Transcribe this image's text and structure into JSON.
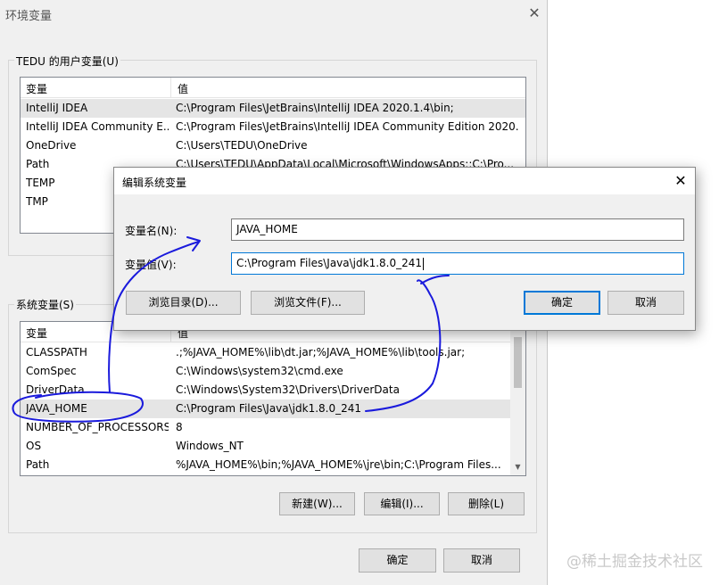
{
  "main": {
    "title": "环境变量",
    "user_group_label": "TEDU 的用户变量(U)",
    "user_table": {
      "col_variable": "变量",
      "col_value": "值",
      "rows": [
        {
          "name": "IntelliJ IDEA",
          "value": "C:\\Program Files\\JetBrains\\IntelliJ IDEA 2020.1.4\\bin;"
        },
        {
          "name": "IntelliJ IDEA Community E...",
          "value": "C:\\Program Files\\JetBrains\\IntelliJ IDEA Community Edition 2020...."
        },
        {
          "name": "OneDrive",
          "value": "C:\\Users\\TEDU\\OneDrive"
        },
        {
          "name": "Path",
          "value": "C:\\Users\\TEDU\\AppData\\Local\\Microsoft\\WindowsApps;;C:\\Pro..."
        },
        {
          "name": "TEMP",
          "value": ""
        },
        {
          "name": "TMP",
          "value": ""
        }
      ]
    },
    "system_group_label": "系统变量(S)",
    "system_table": {
      "col_variable": "变量",
      "col_value": "值",
      "rows": [
        {
          "name": "CLASSPATH",
          "value": ".;%JAVA_HOME%\\lib\\dt.jar;%JAVA_HOME%\\lib\\tools.jar;"
        },
        {
          "name": "ComSpec",
          "value": "C:\\Windows\\system32\\cmd.exe"
        },
        {
          "name": "DriverData",
          "value": "C:\\Windows\\System32\\Drivers\\DriverData"
        },
        {
          "name": "JAVA_HOME",
          "value": "C:\\Program Files\\Java\\jdk1.8.0_241"
        },
        {
          "name": "NUMBER_OF_PROCESSORS",
          "value": "8"
        },
        {
          "name": "OS",
          "value": "Windows_NT"
        },
        {
          "name": "Path",
          "value": "%JAVA_HOME%\\bin;%JAVA_HOME%\\jre\\bin;C:\\Program Files..."
        }
      ]
    },
    "btn_new": "新建(W)...",
    "btn_edit": "编辑(I)...",
    "btn_delete": "删除(L)",
    "btn_ok": "确定",
    "btn_cancel": "取消"
  },
  "edit_dialog": {
    "title": "编辑系统变量",
    "name_label": "变量名(N):",
    "name_value": "JAVA_HOME",
    "value_label": "变量值(V):",
    "value_value": "C:\\Program Files\\Java\\jdk1.8.0_241",
    "btn_browse_dir": "浏览目录(D)...",
    "btn_browse_file": "浏览文件(F)...",
    "btn_ok": "确定",
    "btn_cancel": "取消"
  },
  "watermark": "@稀土掘金技术社区",
  "colors": {
    "accent": "#0078d7",
    "annotation": "#1a1adc",
    "selection": "#e5e5e5"
  }
}
